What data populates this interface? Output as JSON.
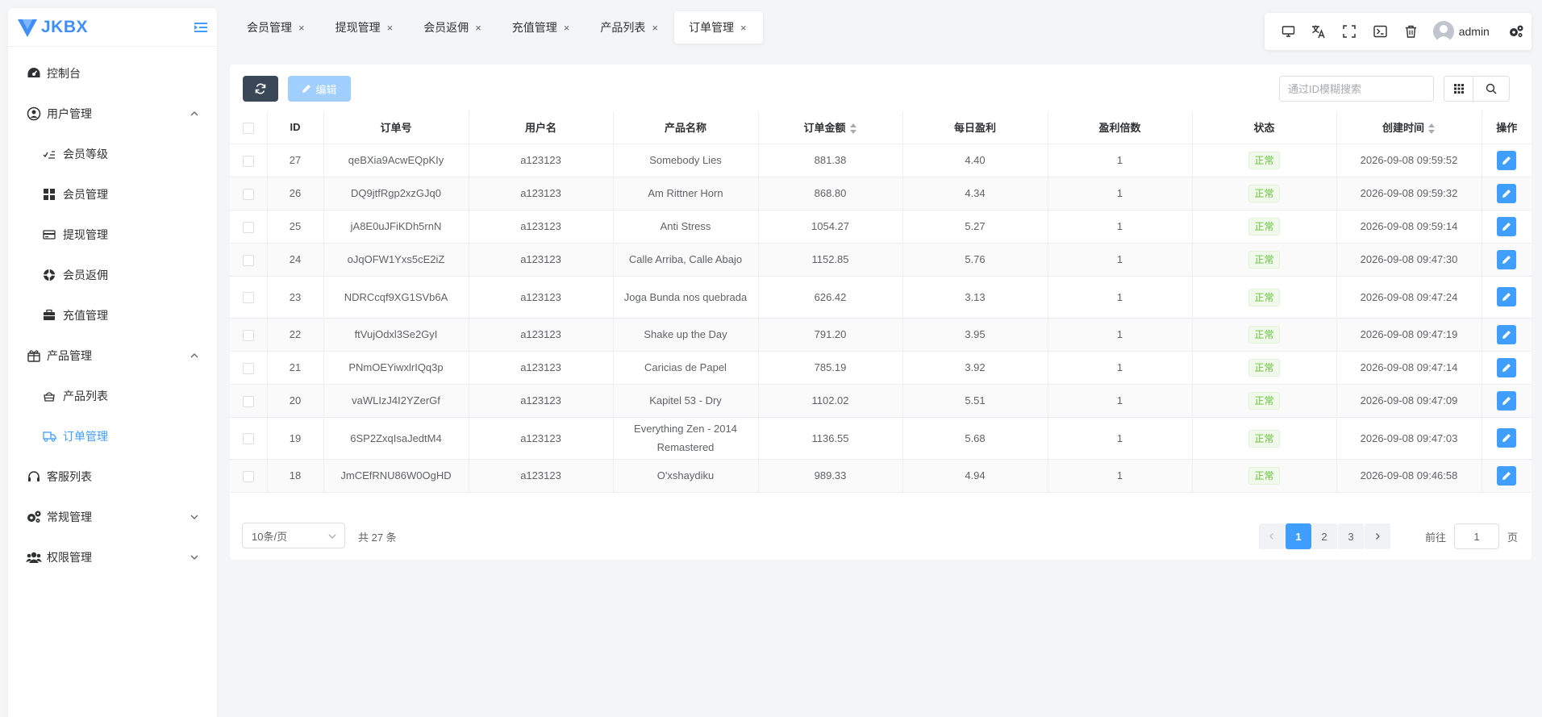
{
  "app": {
    "logo_text": "JKBX"
  },
  "sidebar": {
    "items": [
      {
        "label": "控制台"
      },
      {
        "label": "用户管理"
      },
      {
        "label": "会员等级"
      },
      {
        "label": "会员管理"
      },
      {
        "label": "提现管理"
      },
      {
        "label": "会员返佣"
      },
      {
        "label": "充值管理"
      },
      {
        "label": "产品管理"
      },
      {
        "label": "产品列表"
      },
      {
        "label": "订单管理"
      },
      {
        "label": "客服列表"
      },
      {
        "label": "常规管理"
      },
      {
        "label": "权限管理"
      }
    ]
  },
  "tabs": [
    {
      "label": "会员管理",
      "close": "×"
    },
    {
      "label": "提现管理",
      "close": "×"
    },
    {
      "label": "会员返佣",
      "close": "×"
    },
    {
      "label": "充值管理",
      "close": "×"
    },
    {
      "label": "产品列表",
      "close": "×"
    },
    {
      "label": "订单管理",
      "close": "×"
    }
  ],
  "toolbar": {
    "username": "admin"
  },
  "actions": {
    "edit_label": "编辑",
    "search_placeholder": "通过ID模糊搜索"
  },
  "table": {
    "headers": {
      "id": "ID",
      "order_no": "订单号",
      "username": "用户名",
      "product": "产品名称",
      "amount": "订单金额",
      "daily_profit": "每日盈利",
      "multiplier": "盈利倍数",
      "status": "状态",
      "created": "创建时间",
      "ops": "操作"
    },
    "rows": [
      {
        "id": "27",
        "order_no": "qeBXia9AcwEQpKIy",
        "username": "a123123",
        "product": "Somebody Lies",
        "amount": "881.38",
        "daily_profit": "4.40",
        "multiplier": "1",
        "status": "正常",
        "created": "2026-09-08 09:59:52"
      },
      {
        "id": "26",
        "order_no": "DQ9jtfRgp2xzGJq0",
        "username": "a123123",
        "product": "Am Rittner Horn",
        "amount": "868.80",
        "daily_profit": "4.34",
        "multiplier": "1",
        "status": "正常",
        "created": "2026-09-08 09:59:32"
      },
      {
        "id": "25",
        "order_no": "jA8E0uJFiKDh5rnN",
        "username": "a123123",
        "product": "Anti Stress",
        "amount": "1054.27",
        "daily_profit": "5.27",
        "multiplier": "1",
        "status": "正常",
        "created": "2026-09-08 09:59:14"
      },
      {
        "id": "24",
        "order_no": "oJqOFW1Yxs5cE2iZ",
        "username": "a123123",
        "product": "Calle Arriba, Calle Abajo",
        "amount": "1152.85",
        "daily_profit": "5.76",
        "multiplier": "1",
        "status": "正常",
        "created": "2026-09-08 09:47:30"
      },
      {
        "id": "23",
        "order_no": "NDRCcqf9XG1SVb6A",
        "username": "a123123",
        "product": "Joga Bunda nos quebrada",
        "amount": "626.42",
        "daily_profit": "3.13",
        "multiplier": "1",
        "status": "正常",
        "created": "2026-09-08 09:47:24"
      },
      {
        "id": "22",
        "order_no": "ftVujOdxl3Se2GyI",
        "username": "a123123",
        "product": "Shake up the Day",
        "amount": "791.20",
        "daily_profit": "3.95",
        "multiplier": "1",
        "status": "正常",
        "created": "2026-09-08 09:47:19"
      },
      {
        "id": "21",
        "order_no": "PNmOEYiwxlrIQq3p",
        "username": "a123123",
        "product": "Caricias de Papel",
        "amount": "785.19",
        "daily_profit": "3.92",
        "multiplier": "1",
        "status": "正常",
        "created": "2026-09-08 09:47:14"
      },
      {
        "id": "20",
        "order_no": "vaWLIzJ4I2YZerGf",
        "username": "a123123",
        "product": "Kapitel 53 - Dry",
        "amount": "1102.02",
        "daily_profit": "5.51",
        "multiplier": "1",
        "status": "正常",
        "created": "2026-09-08 09:47:09"
      },
      {
        "id": "19",
        "order_no": "6SP2ZxqIsaJedtM4",
        "username": "a123123",
        "product": "Everything Zen - 2014 Remastered",
        "amount": "1136.55",
        "daily_profit": "5.68",
        "multiplier": "1",
        "status": "正常",
        "created": "2026-09-08 09:47:03"
      },
      {
        "id": "18",
        "order_no": "JmCEfRNU86W0OgHD",
        "username": "a123123",
        "product": "O'xshaydiku",
        "amount": "989.33",
        "daily_profit": "4.94",
        "multiplier": "1",
        "status": "正常",
        "created": "2026-09-08 09:46:58"
      }
    ]
  },
  "pagination": {
    "page_size": "10条/页",
    "total": "共 27 条",
    "pages": [
      "1",
      "2",
      "3"
    ],
    "current": "1",
    "goto_label": "前往",
    "goto_value": "1",
    "goto_suffix": "页"
  },
  "colors": {
    "primary": "#409eff",
    "success": "#67c23a",
    "dark_button": "#3a4756",
    "logo": "#3f8ff7"
  }
}
